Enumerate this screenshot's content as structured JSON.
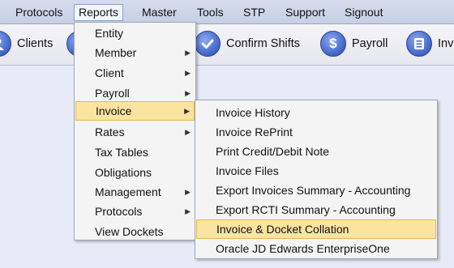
{
  "menubar": {
    "items": [
      "Protocols",
      "Reports",
      "Master",
      "Tools",
      "STP",
      "Support",
      "Signout"
    ],
    "active": "Reports"
  },
  "toolbar": {
    "clients_label": "Clients",
    "confirm_shifts_label": "Confirm Shifts",
    "payroll_label": "Payroll",
    "invoice_partial_label": "Inv"
  },
  "reports_menu": {
    "items": [
      {
        "label": "Entity",
        "submenu": false
      },
      {
        "label": "Member",
        "submenu": true
      },
      {
        "label": "Client",
        "submenu": true
      },
      {
        "label": "Payroll",
        "submenu": true
      },
      {
        "label": "Invoice",
        "submenu": true,
        "highlighted": true
      },
      {
        "label": "Rates",
        "submenu": true
      },
      {
        "label": "Tax Tables",
        "submenu": false
      },
      {
        "label": "Obligations",
        "submenu": false
      },
      {
        "label": "Management",
        "submenu": true
      },
      {
        "label": "Protocols",
        "submenu": true
      },
      {
        "label": "View Dockets",
        "submenu": false
      }
    ]
  },
  "invoice_submenu": {
    "items": [
      {
        "label": "Invoice History"
      },
      {
        "label": "Invoice RePrint"
      },
      {
        "label": "Print Credit/Debit Note"
      },
      {
        "label": "Invoice Files"
      },
      {
        "label": "Export Invoices Summary - Accounting"
      },
      {
        "label": "Export RCTI Summary - Accounting"
      },
      {
        "label": "Invoice & Docket Collation",
        "highlighted": true
      },
      {
        "label": "Oracle JD Edwards EnterpriseOne"
      }
    ]
  },
  "icons": {
    "clients": "users-icon",
    "confirm_shifts": "checkmark-icon",
    "payroll": "dollar-icon",
    "invoice": "document-icon"
  },
  "colors": {
    "highlight": "#fbe3a0",
    "highlight_border": "#e5b84f",
    "icon_blue": "#3f63c8",
    "background": "#e8eaf7"
  }
}
